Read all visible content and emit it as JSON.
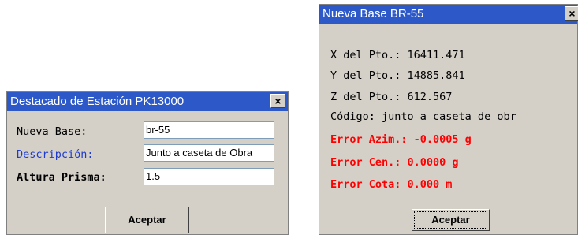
{
  "dialog1": {
    "title": "Destacado de Estación  PK13000",
    "close": "×",
    "fields": [
      {
        "label": "Nueva Base:",
        "value": "br-55"
      },
      {
        "label": "Descripción:",
        "value": "Junto a caseta de Obra"
      },
      {
        "label": "Altura Prisma:",
        "value": "1.5"
      }
    ],
    "button": "Aceptar"
  },
  "dialog2": {
    "title": "Nueva Base  BR-55",
    "close": "×",
    "lines": [
      "X del Pto.:  16411.471",
      "Y del Pto.:  14885.841",
      "Z del Pto.:  612.567",
      "Código: junto a caseta de obr"
    ],
    "errors": [
      "Error Azim.:  -0.0005 g",
      "Error Cen.:    0.0000 g",
      "Error Cota:    0.000 m"
    ],
    "button": "Aceptar"
  },
  "colors": {
    "titlebar": "#2d59c8",
    "dialog_bg": "#d4d0c8",
    "error_text": "#ff0000",
    "link_text": "#1e3bd0"
  }
}
